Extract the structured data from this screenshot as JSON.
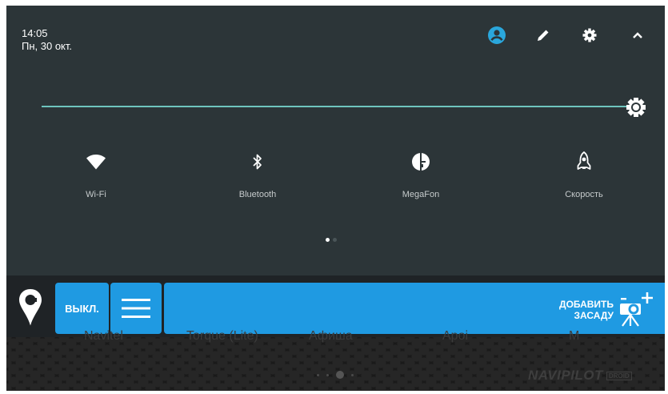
{
  "status": {
    "time": "14:05",
    "date": "Пн, 30 окт."
  },
  "header_icons": [
    "user-icon",
    "edit-icon",
    "gear-icon",
    "chevron-up-icon"
  ],
  "brightness": {
    "level": 0.96,
    "track_color": "#6ec4bd"
  },
  "tiles": [
    {
      "label": "Wi-Fi",
      "icon": "wifi-icon"
    },
    {
      "label": "Bluetooth",
      "icon": "bluetooth-icon"
    },
    {
      "label": "MegaFon",
      "icon": "cellular-sim-icon"
    },
    {
      "label": "Скорость",
      "icon": "rocket-icon"
    }
  ],
  "page_indicator": {
    "pages": 2,
    "current": 1
  },
  "toolbar": {
    "off_label": "ВЫКЛ.",
    "add_ambush_line1": "ДОБАВИТЬ",
    "add_ambush_line2": "ЗАСАДУ",
    "accent": "#1f9ae2"
  },
  "home": {
    "apps": [
      "Navitel",
      "Torque (Lite)",
      "Афиша",
      "Apoi",
      "M"
    ],
    "brand": "NAVIPILOT",
    "brand_sub": "DROID"
  }
}
